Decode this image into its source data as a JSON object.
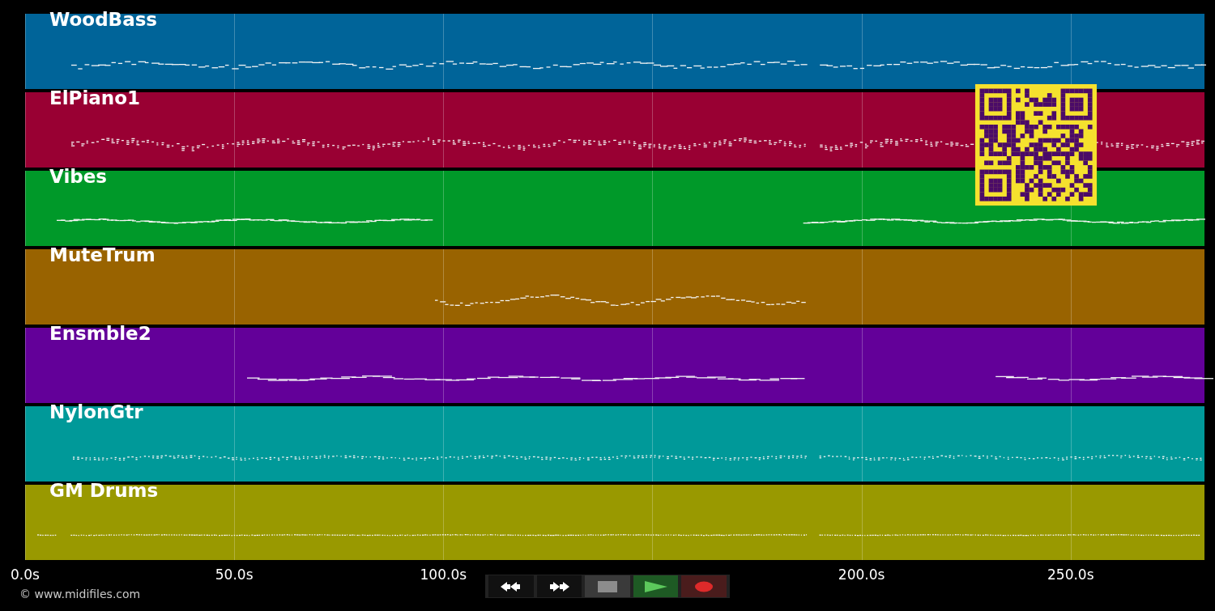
{
  "tracks": [
    {
      "name": "WoodBass",
      "color": "#006499"
    },
    {
      "name": "ElPiano1",
      "color": "#990033"
    },
    {
      "name": "Vibes",
      "color": "#009929"
    },
    {
      "name": "MuteTrum",
      "color": "#996300"
    },
    {
      "name": "Ensmble2",
      "color": "#630099"
    },
    {
      "name": "NylonGtr",
      "color": "#009999"
    },
    {
      "name": "GM Drums",
      "color": "#999900"
    }
  ],
  "x_axis": {
    "ticks": [
      {
        "label": "0.0s"
      },
      {
        "label": "50.0s"
      },
      {
        "label": "100.0s"
      },
      {
        "covered": true
      },
      {
        "label": "200.0s"
      },
      {
        "label": "250.0s"
      }
    ]
  },
  "transport": [
    {
      "kind": "rewind"
    },
    {
      "kind": "forward"
    },
    {
      "kind": "stop"
    },
    {
      "kind": "play"
    },
    {
      "kind": "record"
    }
  ],
  "copyright": "© www.midifiles.com"
}
